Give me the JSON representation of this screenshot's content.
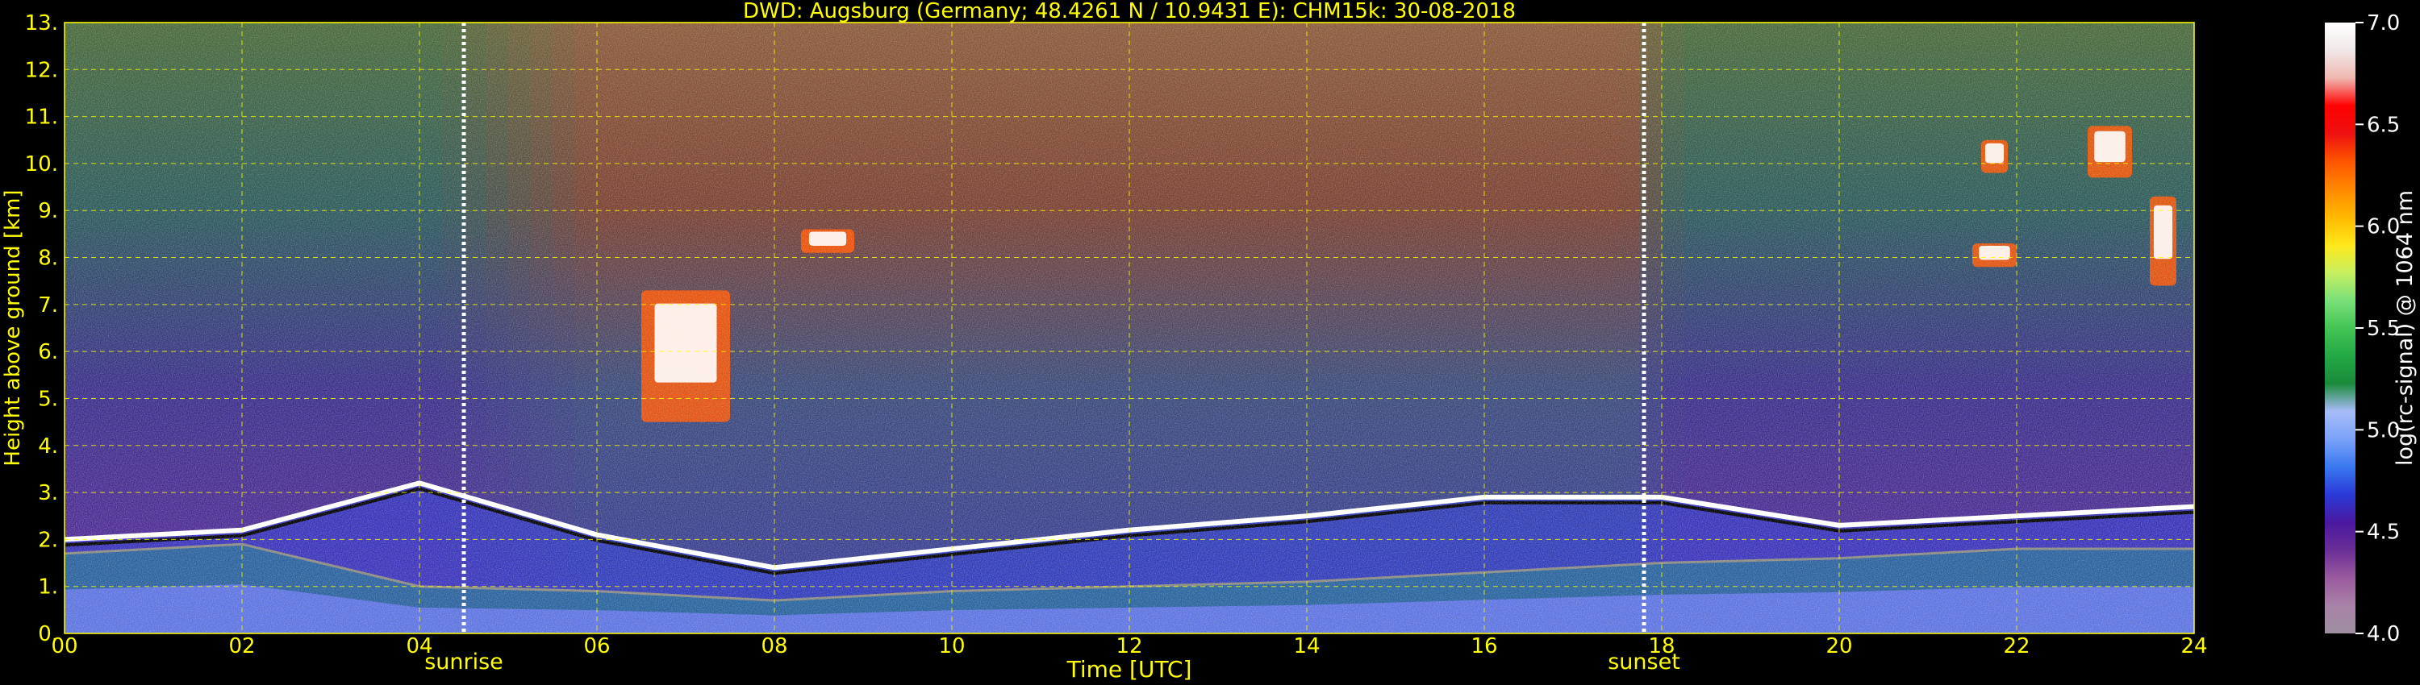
{
  "chart_data": {
    "type": "heatmap",
    "title": "DWD: Augsburg (Germany; 48.4261 N / 10.9431 E):    CHM15k: 30-08-2018",
    "xlabel": "Time [UTC]",
    "ylabel": "Height above ground [km]",
    "x_ticks": [
      "00",
      "02",
      "04",
      "06",
      "08",
      "10",
      "12",
      "14",
      "16",
      "18",
      "20",
      "22",
      "24"
    ],
    "y_ticks": [
      "0.",
      "1.",
      "2.",
      "3.",
      "4.",
      "5.",
      "6.",
      "7.",
      "8.",
      "9.",
      "10.",
      "11.",
      "12.",
      "13."
    ],
    "xlim": [
      0,
      24
    ],
    "ylim": [
      0,
      13
    ],
    "grid": true,
    "grid_color": "#ffff00",
    "markers": [
      {
        "label": "sunrise",
        "time": 4.5
      },
      {
        "label": "sunset",
        "time": 17.8
      }
    ],
    "colorbar": {
      "label": "log(rc-signal) @ 1064 nm",
      "range": [
        4.0,
        7.0
      ],
      "ticks": [
        "4.0",
        "4.5",
        "5.0",
        "5.5",
        "6.0",
        "6.5",
        "7.0"
      ],
      "colors": [
        "#9e8fa0",
        "#a882a8",
        "#9a5a9e",
        "#6a2e96",
        "#4a18a0",
        "#2a3ad8",
        "#3a78f0",
        "#7aa2f8",
        "#a8bcf8",
        "#1a8a3a",
        "#22aa44",
        "#44c455",
        "#7ae07a",
        "#c8f060",
        "#ffe81a",
        "#ffb800",
        "#ff8800",
        "#ff5500",
        "#ee1111",
        "#ff0000",
        "#f0b8b0",
        "#f0e8e8",
        "#ffffff"
      ]
    },
    "layers": [
      {
        "name": "boundary-layer",
        "top_km": [
          1.7,
          1.9,
          1.0,
          0.9,
          0.7,
          0.9,
          1.0,
          1.1,
          1.3,
          1.5,
          1.6,
          1.8,
          1.8
        ]
      },
      {
        "name": "residual-layer-top",
        "top_km": [
          2.0,
          2.2,
          3.2,
          2.1,
          1.4,
          1.8,
          2.2,
          2.5,
          2.9,
          2.9,
          2.3,
          2.5,
          2.7
        ]
      },
      {
        "name": "cloud",
        "t_start": 6.5,
        "t_end": 7.5,
        "base_km": 4.5,
        "top_km": 7.3
      },
      {
        "name": "cloud",
        "t_start": 8.3,
        "t_end": 8.9,
        "base_km": 8.1,
        "top_km": 8.6
      },
      {
        "name": "cloud",
        "t_start": 21.5,
        "t_end": 22.0,
        "base_km": 7.8,
        "top_km": 8.3
      },
      {
        "name": "cloud",
        "t_start": 21.6,
        "t_end": 21.9,
        "base_km": 9.8,
        "top_km": 10.5
      },
      {
        "name": "cloud",
        "t_start": 22.8,
        "t_end": 23.3,
        "base_km": 9.7,
        "top_km": 10.8
      },
      {
        "name": "cloud",
        "t_start": 23.5,
        "t_end": 23.8,
        "base_km": 7.4,
        "top_km": 9.3
      }
    ]
  }
}
